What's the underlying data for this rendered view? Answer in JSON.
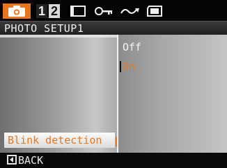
{
  "tabs": {
    "active": "camera-icon",
    "items": [
      {
        "icon": "camera-icon"
      },
      {
        "label": "1"
      },
      {
        "label": "2"
      },
      {
        "icon": "screen-mode-icon"
      },
      {
        "icon": "key-icon"
      },
      {
        "icon": "wave-icon"
      },
      {
        "icon": "memory-card-icon"
      }
    ]
  },
  "header": {
    "title": "PHOTO SETUP1"
  },
  "menu": {
    "selected_label": "Blink detection"
  },
  "options": {
    "items": [
      "Off",
      "On"
    ],
    "selected": "On"
  },
  "footer": {
    "back_label": "BACK"
  },
  "colors": {
    "accent": "#e8761e",
    "bar": "#0a0a0a"
  }
}
